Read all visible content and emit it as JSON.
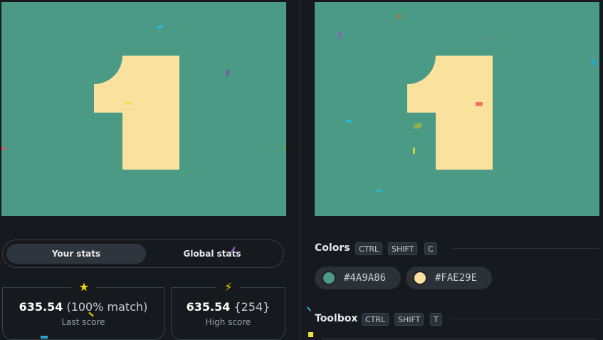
{
  "canvas": {
    "background": "#4A9A86",
    "shape_color": "#FAE29E"
  },
  "stats_toggle": {
    "your_stats": "Your stats",
    "global_stats": "Global stats"
  },
  "last_score": {
    "icon": "star-icon",
    "value": "635.54",
    "match": "(100% match)",
    "label": "Last score"
  },
  "high_score": {
    "icon": "lightning-icon",
    "value": "635.54",
    "rank": "{254}",
    "label": "High score"
  },
  "colors_section": {
    "title": "Colors",
    "shortcut": [
      "CTRL",
      "SHIFT",
      "C"
    ],
    "swatches": [
      {
        "hex": "#4A9A86",
        "color": "#4A9A86"
      },
      {
        "hex": "#FAE29E",
        "color": "#FAE29E"
      }
    ]
  },
  "toolbox_section": {
    "title": "Toolbox",
    "shortcut": [
      "CTRL",
      "SHIFT",
      "T"
    ]
  }
}
